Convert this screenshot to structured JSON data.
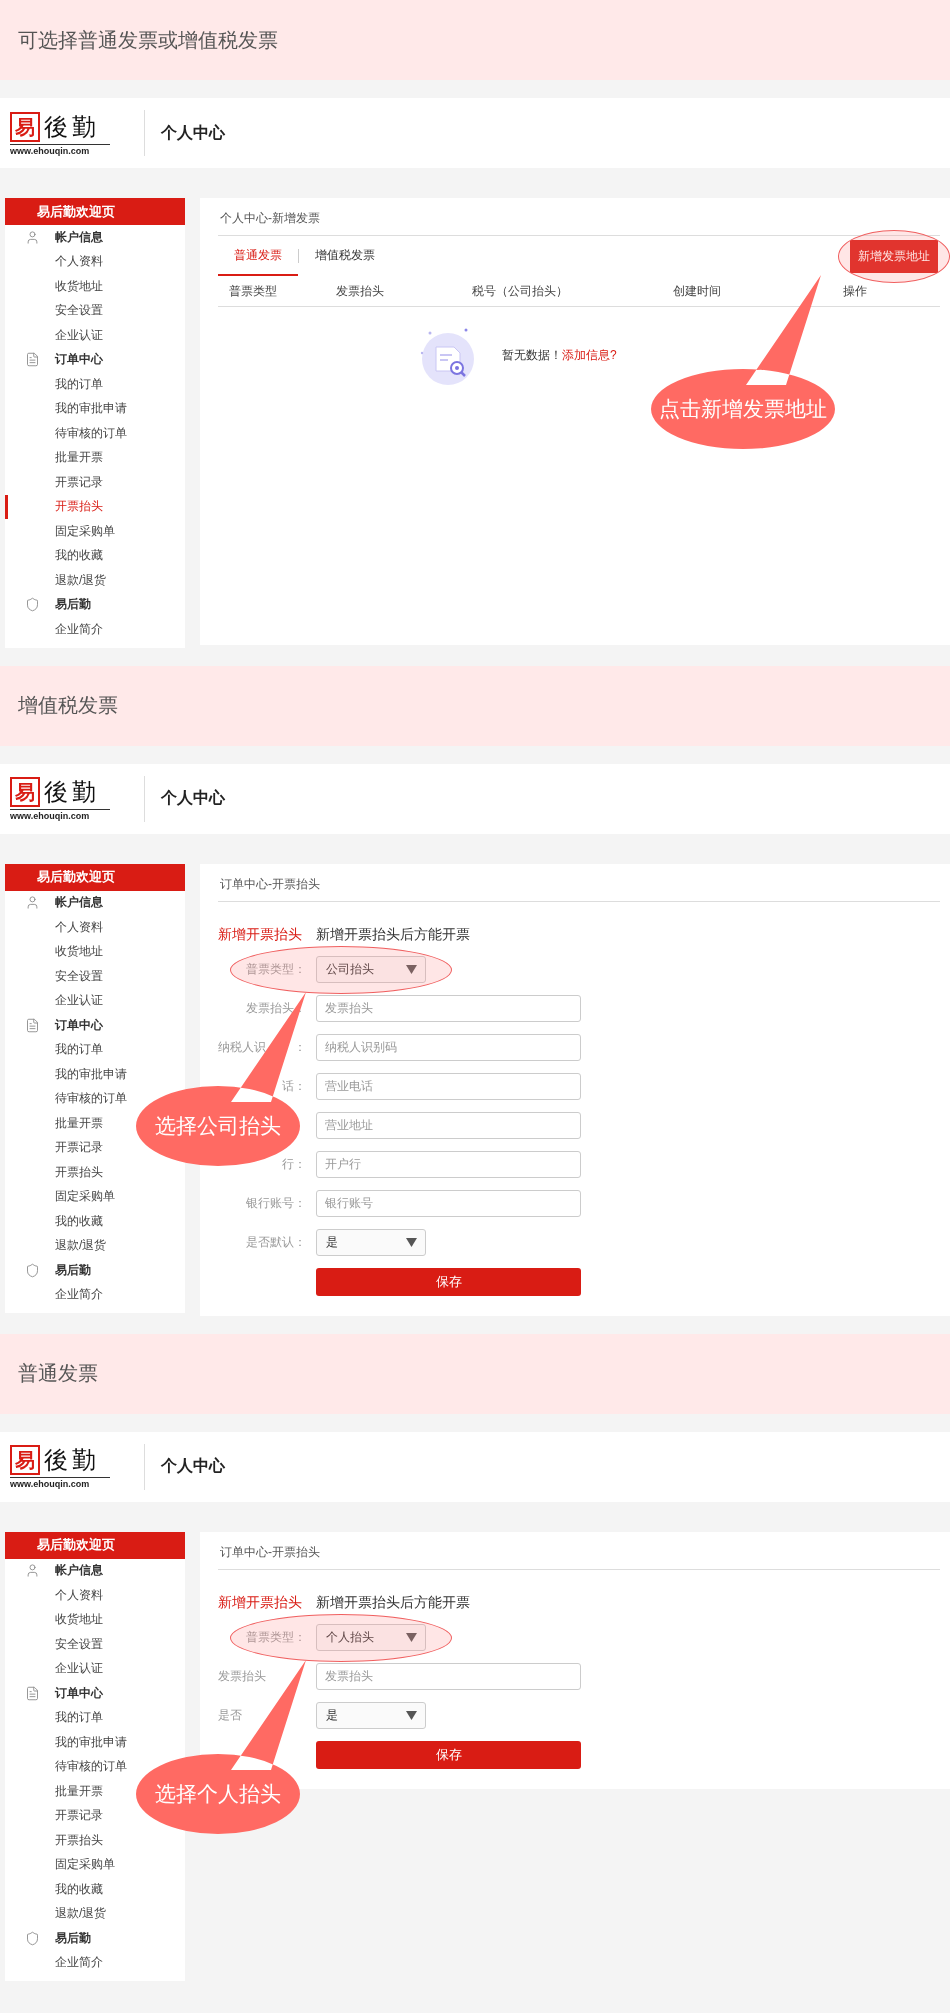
{
  "sections": [
    {
      "banner": "可选择普通发票或增值税发票",
      "header": {
        "logo_mark": "易",
        "logo_name": "後勤",
        "logo_url": "www.ehouqin.com",
        "title": "个人中心"
      },
      "sidebar": {
        "title": "易后勤欢迎页",
        "groups": [
          {
            "label": "帐户信息",
            "items": [
              {
                "label": "个人资料",
                "selected": false
              },
              {
                "label": "收货地址",
                "selected": false
              },
              {
                "label": "安全设置",
                "selected": false
              },
              {
                "label": "企业认证",
                "selected": false
              }
            ]
          },
          {
            "label": "订单中心",
            "items": [
              {
                "label": "我的订单",
                "selected": false
              },
              {
                "label": "我的审批申请",
                "selected": false
              },
              {
                "label": "待审核的订单",
                "selected": false
              },
              {
                "label": "批量开票",
                "selected": false
              },
              {
                "label": "开票记录",
                "selected": false
              },
              {
                "label": "开票抬头",
                "selected": true
              },
              {
                "label": "固定采购单",
                "selected": false
              },
              {
                "label": "我的收藏",
                "selected": false
              },
              {
                "label": "退款/退货",
                "selected": false
              }
            ]
          },
          {
            "label": "易后勤",
            "items": [
              {
                "label": "企业简介",
                "selected": false
              }
            ]
          }
        ]
      },
      "content": {
        "kind": "list",
        "breadcrumb": "个人中心-新增发票",
        "tabs": [
          {
            "label": "普通发票",
            "selected": true
          },
          {
            "label": "增值税发票",
            "selected": false
          }
        ],
        "add_button": {
          "label": "新增发票地址",
          "highlighted": true
        },
        "columns": [
          "普票类型",
          "发票抬头",
          "税号（公司抬头）",
          "创建时间",
          "操作"
        ],
        "empty": {
          "message": "暂无数据！",
          "link": "添加信息?"
        }
      },
      "callout": {
        "text": "点击新增发票地址"
      }
    },
    {
      "banner": "增值税发票",
      "header": {
        "logo_mark": "易",
        "logo_name": "後勤",
        "logo_url": "www.ehouqin.com",
        "title": "个人中心"
      },
      "sidebar": {
        "title": "易后勤欢迎页",
        "groups": [
          {
            "label": "帐户信息",
            "items": [
              {
                "label": "个人资料",
                "selected": false
              },
              {
                "label": "收货地址",
                "selected": false
              },
              {
                "label": "安全设置",
                "selected": false
              },
              {
                "label": "企业认证",
                "selected": false
              }
            ]
          },
          {
            "label": "订单中心",
            "items": [
              {
                "label": "我的订单",
                "selected": false
              },
              {
                "label": "我的审批申请",
                "selected": false
              },
              {
                "label": "待审核的订单",
                "selected": false
              },
              {
                "label": "批量开票",
                "selected": false
              },
              {
                "label": "开票记录",
                "selected": false
              },
              {
                "label": "开票抬头",
                "selected": false
              },
              {
                "label": "固定采购单",
                "selected": false
              },
              {
                "label": "我的收藏",
                "selected": false
              },
              {
                "label": "退款/退货",
                "selected": false
              }
            ]
          },
          {
            "label": "易后勤",
            "items": [
              {
                "label": "企业简介",
                "selected": false
              }
            ]
          }
        ]
      },
      "content": {
        "kind": "form",
        "breadcrumb": "订单中心-开票抬头",
        "heading": "新增开票抬头",
        "hint": "新增开票抬头后方能开票",
        "fields": [
          {
            "kind": "select",
            "label": "普票类型：",
            "value": "公司抬头",
            "highlighted": true
          },
          {
            "kind": "input",
            "label": "发票抬头：",
            "placeholder": "发票抬头",
            "highlighted": false
          },
          {
            "kind": "input",
            "label_head": "纳税人识",
            "label": "：",
            "placeholder": "纳税人识别码",
            "highlighted": false
          },
          {
            "kind": "input",
            "label": "话：",
            "placeholder": "营业电话",
            "highlighted": false
          },
          {
            "kind": "input",
            "placeholder": "营业地址",
            "highlighted": false
          },
          {
            "kind": "input",
            "label": "行：",
            "placeholder": "开户行",
            "highlighted": false
          },
          {
            "kind": "input",
            "label": "银行账号：",
            "placeholder": "银行账号",
            "highlighted": false
          },
          {
            "kind": "select",
            "label": "是否默认：",
            "value": "是",
            "highlighted": false
          }
        ],
        "save_button": "保存"
      },
      "callout": {
        "text": "选择公司抬头"
      }
    },
    {
      "banner": "普通发票",
      "header": {
        "logo_mark": "易",
        "logo_name": "後勤",
        "logo_url": "www.ehouqin.com",
        "title": "个人中心"
      },
      "sidebar": {
        "title": "易后勤欢迎页",
        "groups": [
          {
            "label": "帐户信息",
            "items": [
              {
                "label": "个人资料",
                "selected": false
              },
              {
                "label": "收货地址",
                "selected": false
              },
              {
                "label": "安全设置",
                "selected": false
              },
              {
                "label": "企业认证",
                "selected": false
              }
            ]
          },
          {
            "label": "订单中心",
            "items": [
              {
                "label": "我的订单",
                "selected": false
              },
              {
                "label": "我的审批申请",
                "selected": false
              },
              {
                "label": "待审核的订单",
                "selected": false
              },
              {
                "label": "批量开票",
                "selected": false
              },
              {
                "label": "开票记录",
                "selected": false
              },
              {
                "label": "开票抬头",
                "selected": false
              },
              {
                "label": "固定采购单",
                "selected": false
              },
              {
                "label": "我的收藏",
                "selected": false
              },
              {
                "label": "退款/退货",
                "selected": false
              }
            ]
          },
          {
            "label": "易后勤",
            "items": [
              {
                "label": "企业简介",
                "selected": false
              }
            ]
          }
        ]
      },
      "content": {
        "kind": "form",
        "breadcrumb": "订单中心-开票抬头",
        "heading": "新增开票抬头",
        "hint": "新增开票抬头后方能开票",
        "fields": [
          {
            "kind": "select",
            "label": "普票类型：",
            "value": "个人抬头",
            "highlighted": true
          },
          {
            "kind": "input",
            "label_head": "发票抬头",
            "placeholder": "发票抬头",
            "highlighted": false
          },
          {
            "kind": "select",
            "label_head": "是否",
            "value": "是",
            "highlighted": false
          }
        ],
        "save_button": "保存"
      },
      "callout": {
        "text": "选择个人抬头"
      }
    }
  ]
}
